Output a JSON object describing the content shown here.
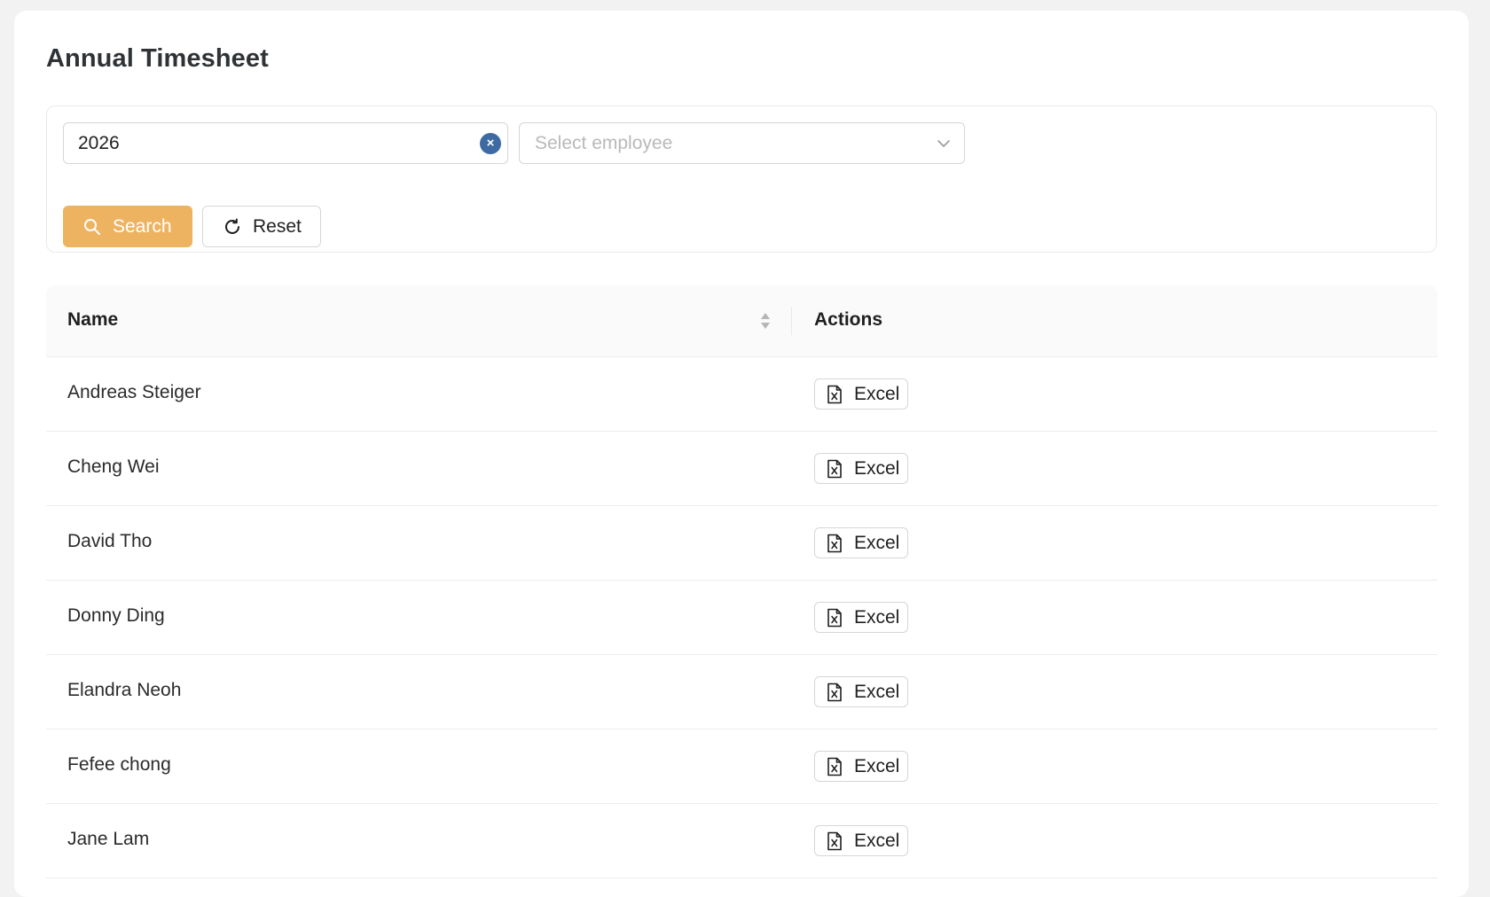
{
  "page": {
    "title": "Annual Timesheet"
  },
  "filters": {
    "year_value": "2026",
    "employee_placeholder": "Select employee",
    "search_label": "Search",
    "reset_label": "Reset"
  },
  "table": {
    "columns": [
      "Name",
      "Actions"
    ],
    "rows": [
      {
        "name": "Andreas Steiger",
        "action": "Excel"
      },
      {
        "name": "Cheng Wei",
        "action": "Excel"
      },
      {
        "name": "David Tho",
        "action": "Excel"
      },
      {
        "name": "Donny Ding",
        "action": "Excel"
      },
      {
        "name": "Elandra Neoh",
        "action": "Excel"
      },
      {
        "name": "Fefee chong",
        "action": "Excel"
      },
      {
        "name": "Jane Lam",
        "action": "Excel"
      }
    ]
  },
  "icons": {
    "clear": "close-circle-icon",
    "dropdown": "chevron-down-icon",
    "search": "search-icon",
    "reset": "refresh-icon",
    "sort": "sort-icon",
    "excel": "excel-file-icon"
  },
  "colors": {
    "primary": "#eeb360",
    "clear_badge": "#3d6aa3"
  }
}
